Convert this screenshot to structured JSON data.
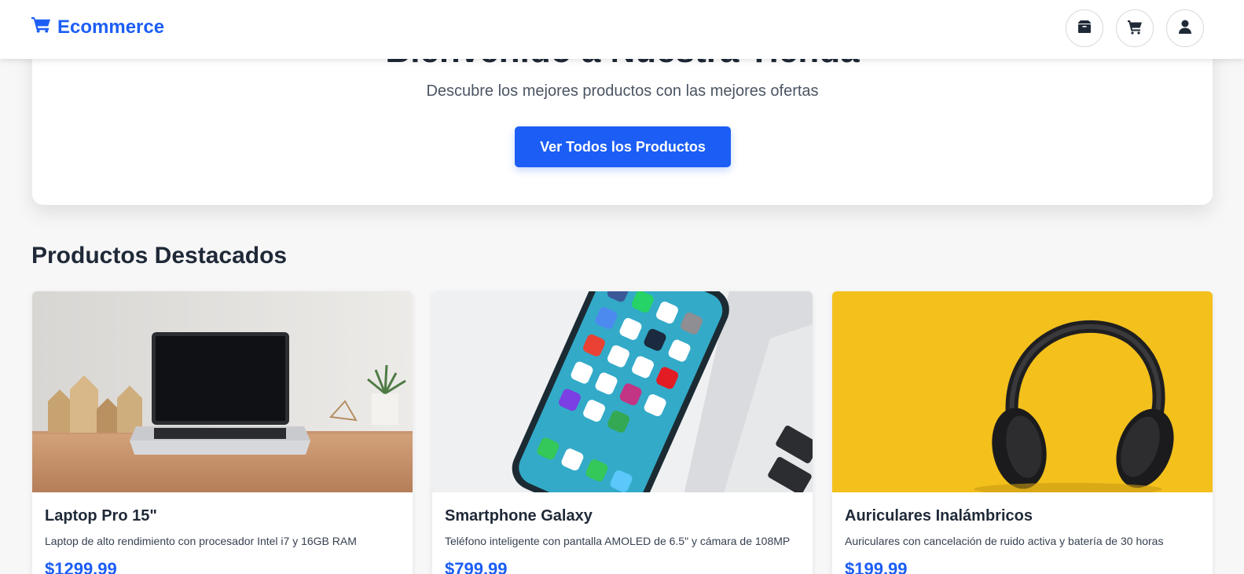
{
  "header": {
    "brand": "Ecommerce",
    "icons": [
      "box-icon",
      "cart-icon",
      "user-icon"
    ]
  },
  "hero": {
    "title": "Bienvenido a Nuestra Tienda",
    "subtitle": "Descubre los mejores productos con las mejores ofertas",
    "cta_label": "Ver Todos los Productos"
  },
  "featured": {
    "title": "Productos Destacados",
    "products": [
      {
        "name": "Laptop Pro 15\"",
        "description": "Laptop de alto rendimiento con procesador Intel i7 y 16GB RAM",
        "price": "$1299.99"
      },
      {
        "name": "Smartphone Galaxy",
        "description": "Teléfono inteligente con pantalla AMOLED de 6.5\" y cámara de 108MP",
        "price": "$799.99"
      },
      {
        "name": "Auriculares Inalámbricos",
        "description": "Auriculares con cancelación de ruido activa y batería de 30 horas",
        "price": "$199.99"
      }
    ]
  },
  "colors": {
    "accent": "#1c5ef5",
    "text": "#1f2937",
    "background": "#f7f7f8"
  }
}
